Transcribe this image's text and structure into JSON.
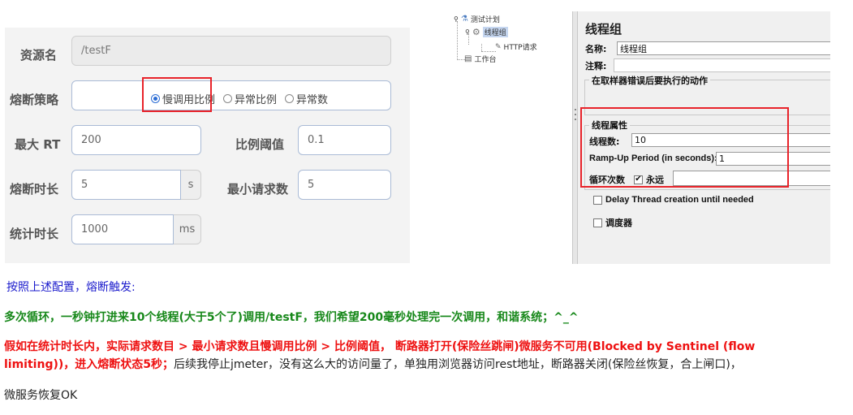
{
  "sentinel_form": {
    "resource_name_label": "资源名",
    "resource_name_value": "/testF",
    "strategy_label": "熔断策略",
    "strategy_options": [
      "慢调用比例",
      "异常比例",
      "异常数"
    ],
    "strategy_selected": "慢调用比例",
    "max_rt_label": "最大 RT",
    "max_rt_value": "200",
    "ratio_threshold_label": "比例阈值",
    "ratio_threshold_value": "0.1",
    "break_duration_label": "熔断时长",
    "break_duration_value": "5",
    "break_duration_unit": "s",
    "min_requests_label": "最小请求数",
    "min_requests_value": "5",
    "stat_duration_label": "统计时长",
    "stat_duration_value": "1000",
    "stat_duration_unit": "ms"
  },
  "jmeter": {
    "tree": {
      "test_plan": "测试计划",
      "thread_group": "线程组",
      "http_request": "HTTP请求",
      "workbench": "工作台"
    },
    "panel_title": "线程组",
    "name_label": "名称:",
    "name_value": "线程组",
    "comment_label": "注释:",
    "error_action_label": "在取样器错误后要执行的动作",
    "thread_props_label": "线程属性",
    "threads_label": "线程数:",
    "threads_value": "10",
    "rampup_label": "Ramp-Up Period (in seconds):",
    "rampup_value": "1",
    "loop_label": "循环次数",
    "forever_label": "永远",
    "forever_checked": true,
    "delay_label": "Delay Thread creation until needed",
    "scheduler_label": "调度器"
  },
  "notes": {
    "line1": "按照上述配置，熔断触发:",
    "line2": "多次循环，一秒钟打进来10个线程(大于5个了)调用/testF，我们希望200毫秒处理完一次调用，和谐系统；^_^",
    "line3": "假如在统计时长内，实际请求数目 > 最小请求数且慢调用比例 > 比例阈值， 断路器打开(保险丝跳闸)微服务不可用(Blocked by Sentinel (flow",
    "line4_red": "limiting))，进入熔断状态5秒；",
    "line4_black": "后续我停止jmeter，没有这么大的访问量了，单独用浏览器访问rest地址，断路器关闭(保险丝恢复，合上闸口)，",
    "line5": "微服务恢复OK"
  },
  "colors": {
    "highlight_box": "#e8232a",
    "radio_accent": "#2b6cd4",
    "note_blue": "#1a1acc",
    "note_green": "#17881a",
    "note_red": "#ee1111"
  }
}
